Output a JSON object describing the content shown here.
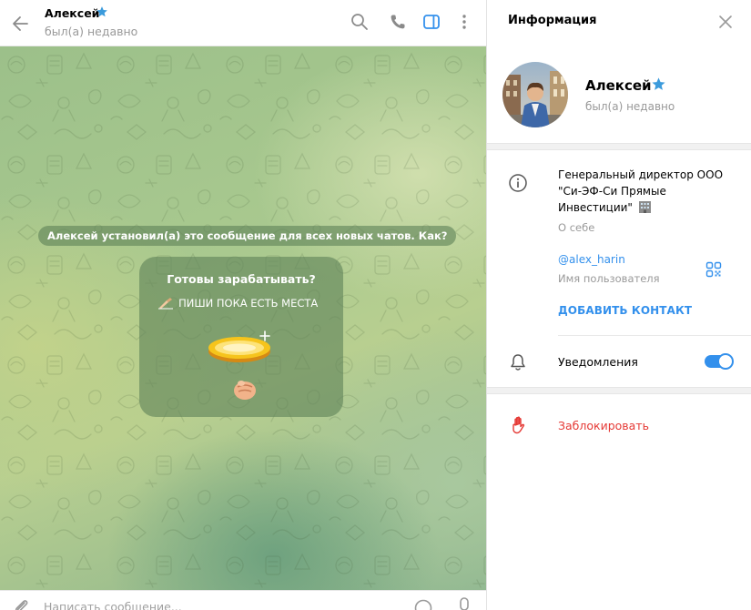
{
  "chat": {
    "peer_name": "Алексей",
    "peer_status": "был(а) недавно",
    "service_message": "Алексей установил(а) это сообщение для всех новых чатов. Как?",
    "greeting": {
      "title": "Готовы зарабатывать?",
      "subtitle": "ПИШИ ПОКА ЕСТЬ МЕСТА"
    },
    "composer_placeholder": "Написать сообщение..."
  },
  "info_panel": {
    "title": "Информация",
    "profile": {
      "name": "Алексей",
      "status": "был(а) недавно"
    },
    "bio": "Генеральный директор ООО \"Си-ЭФ-Си Прямые Инвестиции\"",
    "bio_label": "О себе",
    "username": "@alex_harin",
    "username_label": "Имя пользователя",
    "add_contact": "ДОБАВИТЬ КОНТАКТ",
    "notifications_label": "Уведомления",
    "notifications_on": true,
    "block_label": "Заблокировать"
  },
  "colors": {
    "accent": "#3390ec",
    "danger": "#e53935",
    "muted_text": "#999999",
    "premium_star": "#3b9bdc"
  },
  "icons": [
    "back-arrow-icon",
    "premium-star-icon",
    "search-icon",
    "phone-icon",
    "sidebar-toggle-icon",
    "more-vertical-icon",
    "close-icon",
    "info-icon",
    "qr-code-icon",
    "bell-icon",
    "block-hand-icon",
    "attach-icon",
    "emoji-icon",
    "microphone-icon"
  ]
}
